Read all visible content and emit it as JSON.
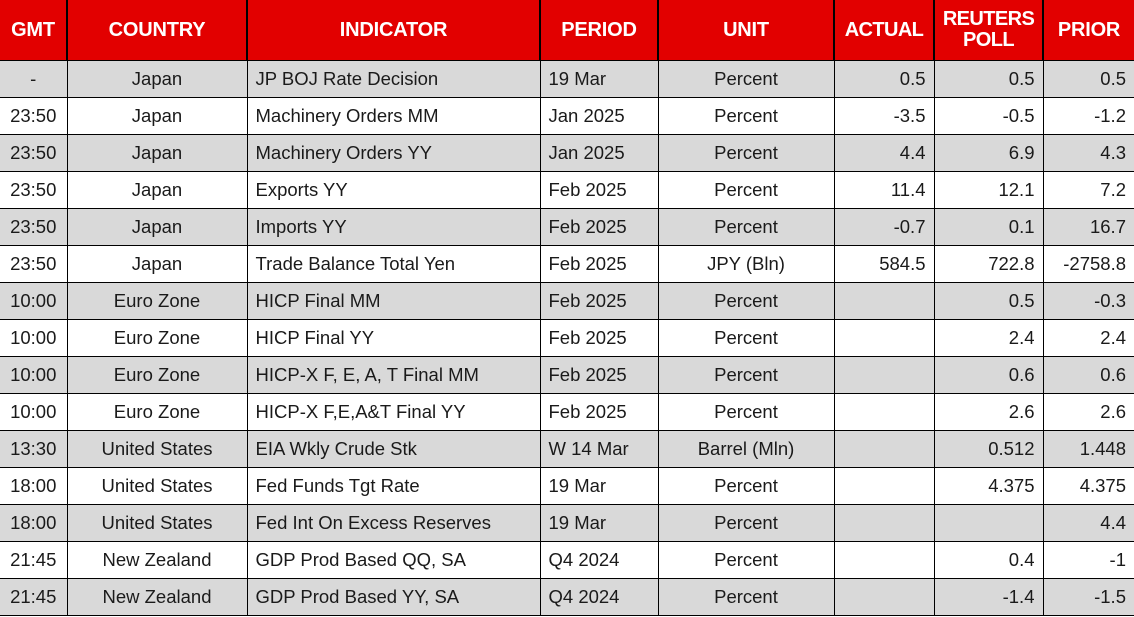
{
  "table": {
    "columns": [
      {
        "key": "gmt",
        "label": "GMT",
        "align": "center",
        "class": "c-gmt"
      },
      {
        "key": "country",
        "label": "COUNTRY",
        "align": "center",
        "class": "c-country"
      },
      {
        "key": "indicator",
        "label": "INDICATOR",
        "align": "left",
        "class": "c-indicator"
      },
      {
        "key": "period",
        "label": "PERIOD",
        "align": "left",
        "class": "c-period"
      },
      {
        "key": "unit",
        "label": "UNIT",
        "align": "center",
        "class": "c-unit"
      },
      {
        "key": "actual",
        "label": "ACTUAL",
        "align": "right",
        "class": "c-actual"
      },
      {
        "key": "poll",
        "label": "REUTERS POLL",
        "align": "right",
        "class": "c-poll"
      },
      {
        "key": "prior",
        "label": "PRIOR",
        "align": "right",
        "class": "c-prior"
      }
    ],
    "colors": {
      "header_background": "#E20000",
      "header_text": "#FFFFFF",
      "row_alt_background": "#D9D9D9",
      "row_plain_background": "#FFFFFF",
      "grid_line": "#000000",
      "body_text": "#1A1A1A"
    },
    "rows": [
      {
        "gmt": "-",
        "country": "Japan",
        "indicator": "JP BOJ Rate Decision",
        "period": "19 Mar",
        "unit": "Percent",
        "actual": "0.5",
        "poll": "0.5",
        "prior": "0.5"
      },
      {
        "gmt": "23:50",
        "country": "Japan",
        "indicator": "Machinery Orders MM",
        "period": "Jan 2025",
        "unit": "Percent",
        "actual": "-3.5",
        "poll": "-0.5",
        "prior": "-1.2"
      },
      {
        "gmt": "23:50",
        "country": "Japan",
        "indicator": "Machinery Orders YY",
        "period": "Jan 2025",
        "unit": "Percent",
        "actual": "4.4",
        "poll": "6.9",
        "prior": "4.3"
      },
      {
        "gmt": "23:50",
        "country": "Japan",
        "indicator": "Exports YY",
        "period": "Feb 2025",
        "unit": "Percent",
        "actual": "11.4",
        "poll": "12.1",
        "prior": "7.2"
      },
      {
        "gmt": "23:50",
        "country": "Japan",
        "indicator": "Imports YY",
        "period": "Feb 2025",
        "unit": "Percent",
        "actual": "-0.7",
        "poll": "0.1",
        "prior": "16.7"
      },
      {
        "gmt": "23:50",
        "country": "Japan",
        "indicator": "Trade Balance Total Yen",
        "period": "Feb 2025",
        "unit": "JPY (Bln)",
        "actual": "584.5",
        "poll": "722.8",
        "prior": "-2758.8"
      },
      {
        "gmt": "10:00",
        "country": "Euro Zone",
        "indicator": "HICP Final MM",
        "period": "Feb 2025",
        "unit": "Percent",
        "actual": "",
        "poll": "0.5",
        "prior": "-0.3"
      },
      {
        "gmt": "10:00",
        "country": "Euro Zone",
        "indicator": "HICP Final YY",
        "period": "Feb 2025",
        "unit": "Percent",
        "actual": "",
        "poll": "2.4",
        "prior": "2.4"
      },
      {
        "gmt": "10:00",
        "country": "Euro Zone",
        "indicator": "HICP-X F, E, A, T Final MM",
        "period": "Feb 2025",
        "unit": "Percent",
        "actual": "",
        "poll": "0.6",
        "prior": "0.6"
      },
      {
        "gmt": "10:00",
        "country": "Euro Zone",
        "indicator": "HICP-X F,E,A&T Final YY",
        "period": "Feb 2025",
        "unit": "Percent",
        "actual": "",
        "poll": "2.6",
        "prior": "2.6"
      },
      {
        "gmt": "13:30",
        "country": "United States",
        "indicator": "EIA Wkly Crude Stk",
        "period": "W 14 Mar",
        "unit": "Barrel (Mln)",
        "actual": "",
        "poll": "0.512",
        "prior": "1.448"
      },
      {
        "gmt": "18:00",
        "country": "United States",
        "indicator": "Fed Funds Tgt Rate",
        "period": "19 Mar",
        "unit": "Percent",
        "actual": "",
        "poll": "4.375",
        "prior": "4.375"
      },
      {
        "gmt": "18:00",
        "country": "United States",
        "indicator": "Fed Int On Excess Reserves",
        "period": "19 Mar",
        "unit": "Percent",
        "actual": "",
        "poll": "",
        "prior": "4.4"
      },
      {
        "gmt": "21:45",
        "country": "New Zealand",
        "indicator": "GDP Prod Based QQ, SA",
        "period": "Q4 2024",
        "unit": "Percent",
        "actual": "",
        "poll": "0.4",
        "prior": "-1"
      },
      {
        "gmt": "21:45",
        "country": "New Zealand",
        "indicator": "GDP Prod Based YY, SA",
        "period": "Q4 2024",
        "unit": "Percent",
        "actual": "",
        "poll": "-1.4",
        "prior": "-1.5"
      }
    ]
  }
}
